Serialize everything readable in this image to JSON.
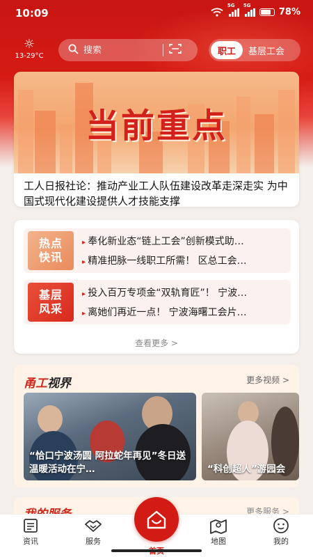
{
  "status_bar": {
    "time": "10:09",
    "network": "5G",
    "battery": "78%"
  },
  "weather": {
    "icon": "sun-icon",
    "temperature": "13-29°C"
  },
  "search": {
    "placeholder": "搜索",
    "search_icon": "search-icon",
    "scan_icon": "scan-icon"
  },
  "role_toggle": {
    "active": "职工",
    "other": "基层工会"
  },
  "banner": {
    "overlay_title": "当前重点",
    "caption": "工人日报社论：推动产业工人队伍建设改革走深走实 为中国式现代化建设提供人才技能支撑"
  },
  "news": {
    "hot": {
      "tag_line1": "热点",
      "tag_line2": "快讯",
      "items": [
        "奉化新业态“链上工会”创新模式助…",
        "精准把脉一线职工所需！ 区总工会…"
      ]
    },
    "grassroots": {
      "tag_line1": "基层",
      "tag_line2": "风采",
      "items": [
        "投入百万专项金“双轨育匠”！ 宁波…",
        "离她们再近一点！ 宁波海曙工会片…"
      ]
    },
    "more": "查看更多 >"
  },
  "videos": {
    "title_part1": "甬工",
    "title_part2": "视界",
    "more": "更多视频 >",
    "items": [
      {
        "caption": "“恰口宁波汤圆 阿拉蛇年再见”冬日送温暖活动在宁…"
      },
      {
        "caption": "“科创超人”游园会"
      }
    ]
  },
  "next_section": {
    "title": "我的服务",
    "more": "更多服务 >"
  },
  "tabbar": [
    {
      "label": "资讯",
      "icon": "news-icon"
    },
    {
      "label": "服务",
      "icon": "handshake-icon"
    },
    {
      "label": "首页",
      "icon": "home-icon"
    },
    {
      "label": "地图",
      "icon": "map-icon"
    },
    {
      "label": "我的",
      "icon": "profile-icon"
    }
  ],
  "colors": {
    "primary": "#d21b14",
    "background": "#f4efea",
    "card_tint": "#fff3e8"
  }
}
